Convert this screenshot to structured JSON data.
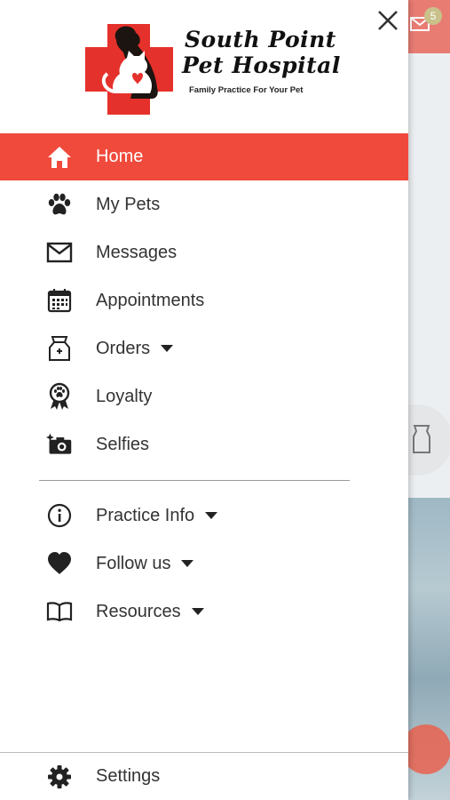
{
  "app": {
    "logo_line1": "South Point",
    "logo_line2": "Pet Hospital",
    "logo_tagline": "Family Practice For Your Pet",
    "brand_color": "#f04a3c"
  },
  "background": {
    "badge_count": "5"
  },
  "menu": {
    "primary": [
      {
        "label": "Home",
        "icon": "home-icon",
        "active": true
      },
      {
        "label": "My Pets",
        "icon": "paw-icon"
      },
      {
        "label": "Messages",
        "icon": "envelope-icon"
      },
      {
        "label": "Appointments",
        "icon": "calendar-icon"
      },
      {
        "label": "Orders",
        "icon": "food-bag-icon",
        "has_dropdown": true
      },
      {
        "label": "Loyalty",
        "icon": "award-ribbon-icon"
      },
      {
        "label": "Selfies",
        "icon": "camera-icon"
      }
    ],
    "secondary": [
      {
        "label": "Practice Info",
        "icon": "info-icon",
        "has_dropdown": true
      },
      {
        "label": "Follow us",
        "icon": "heart-icon",
        "has_dropdown": true
      },
      {
        "label": "Resources",
        "icon": "book-icon",
        "has_dropdown": true
      }
    ],
    "settings": {
      "label": "Settings",
      "icon": "gear-icon"
    }
  }
}
